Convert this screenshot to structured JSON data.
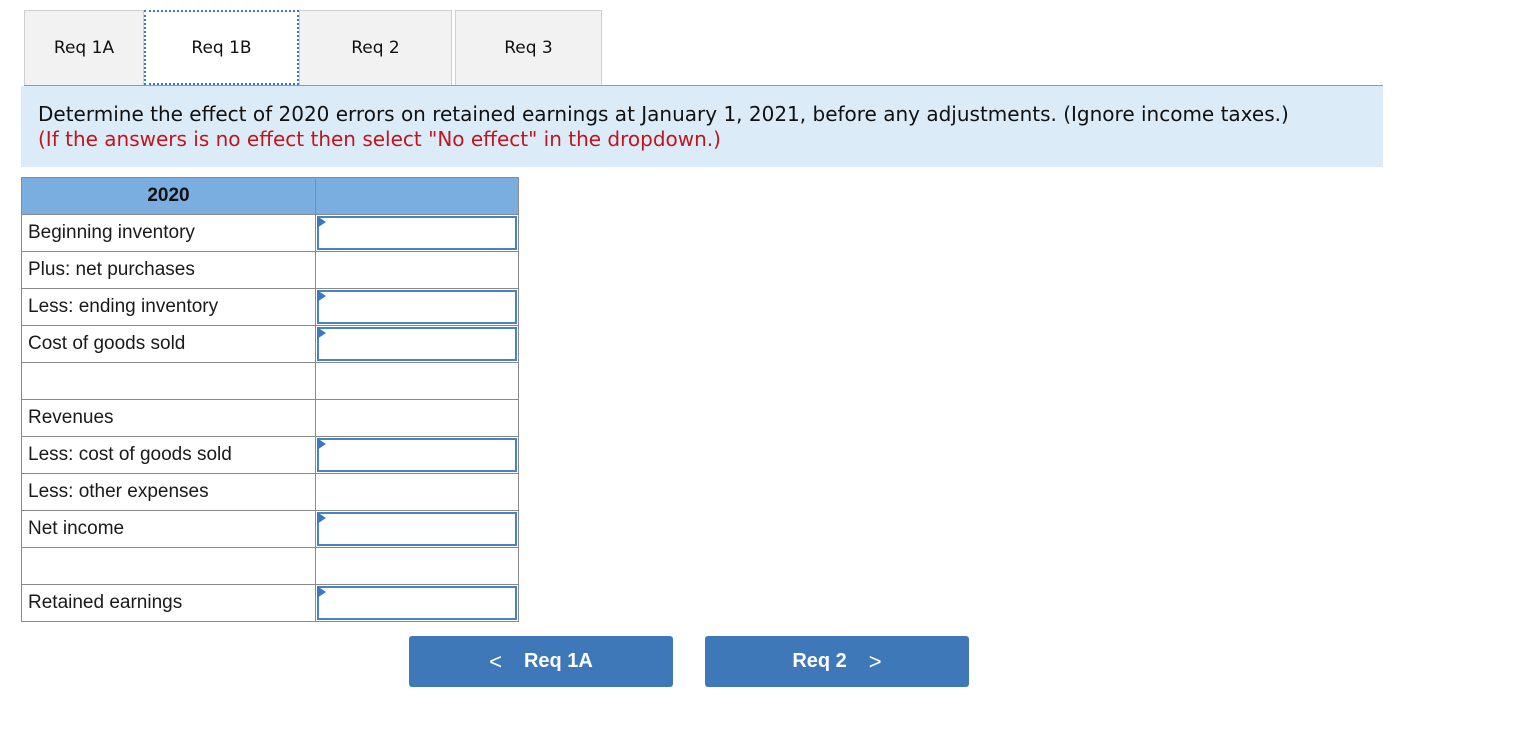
{
  "tabs": [
    {
      "label": "Req 1A",
      "active": false
    },
    {
      "label": "Req 1B",
      "active": true
    },
    {
      "label": "Req 2",
      "active": false
    },
    {
      "label": "Req 3",
      "active": false
    }
  ],
  "instructions": {
    "main": "Determine the effect of 2020 errors on retained earnings at January 1, 2021, before any adjustments. (Ignore income taxes.)",
    "note": "(If the answers is no effect then select \"No effect\" in the dropdown.)"
  },
  "table": {
    "header": {
      "label": "2020",
      "value": ""
    },
    "rows": [
      {
        "label": "Beginning inventory",
        "has_dropdown": true,
        "value": ""
      },
      {
        "label": "Plus: net purchases",
        "has_dropdown": false,
        "value": ""
      },
      {
        "label": "Less: ending inventory",
        "has_dropdown": true,
        "value": ""
      },
      {
        "label": "Cost of goods sold",
        "has_dropdown": true,
        "value": ""
      },
      {
        "label": "",
        "has_dropdown": false,
        "value": ""
      },
      {
        "label": "Revenues",
        "has_dropdown": false,
        "value": ""
      },
      {
        "label": "Less: cost of goods sold",
        "has_dropdown": true,
        "value": ""
      },
      {
        "label": "Less: other expenses",
        "has_dropdown": false,
        "value": ""
      },
      {
        "label": "Net income",
        "has_dropdown": true,
        "value": ""
      },
      {
        "label": "",
        "has_dropdown": false,
        "value": ""
      },
      {
        "label": "Retained earnings",
        "has_dropdown": true,
        "value": ""
      }
    ]
  },
  "nav": {
    "prev": {
      "label": "Req 1A",
      "icon": "chevron-left-icon",
      "glyph": "<"
    },
    "next": {
      "label": "Req 2",
      "icon": "chevron-right-icon",
      "glyph": ">"
    }
  },
  "colors": {
    "accent": "#3e78b8",
    "header_bg": "#7aade0",
    "instruction_bg": "#dcebf8",
    "note_text": "#c0151d"
  }
}
